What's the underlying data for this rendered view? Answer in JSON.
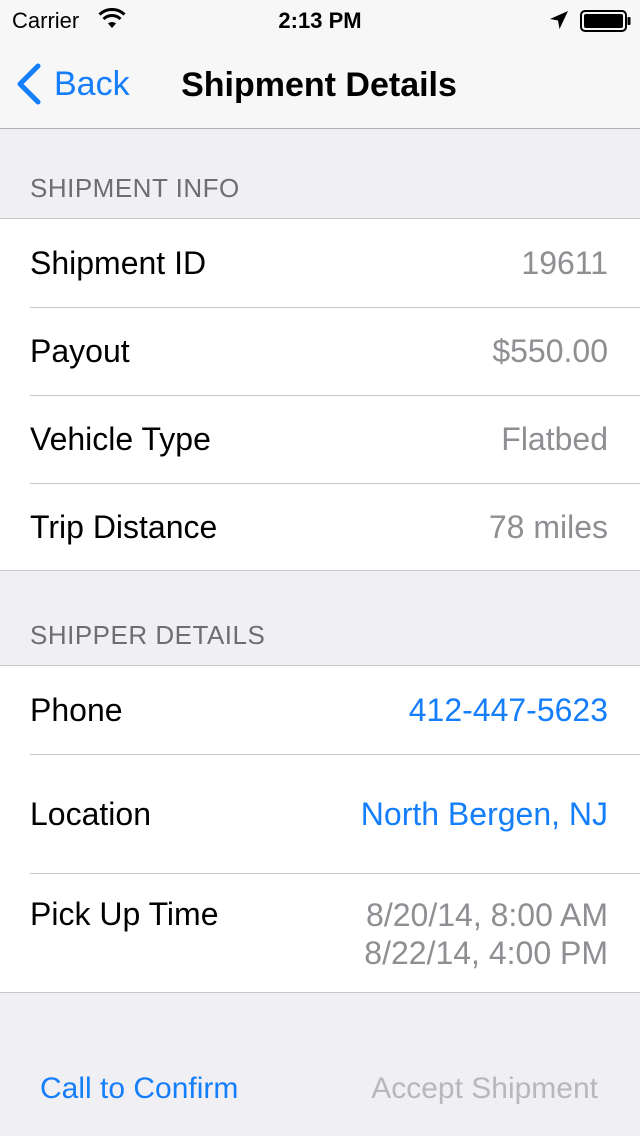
{
  "status_bar": {
    "carrier": "Carrier",
    "time": "2:13 PM",
    "icons": [
      "wifi-icon",
      "location-arrow-icon",
      "battery-icon"
    ]
  },
  "nav": {
    "back_label": "Back",
    "title": "Shipment Details",
    "accent_color": "#147efb"
  },
  "shipment_info": {
    "header": "SHIPMENT INFO",
    "rows": [
      {
        "label": "Shipment ID",
        "value": "19611"
      },
      {
        "label": "Payout",
        "value": "$550.00"
      },
      {
        "label": "Vehicle Type",
        "value": "Flatbed"
      },
      {
        "label": "Trip Distance",
        "value": "78 miles"
      }
    ]
  },
  "shipper_details": {
    "header": "SHIPPER DETAILS",
    "phone": {
      "label": "Phone",
      "value": "412-447-5623"
    },
    "location": {
      "label": "Location",
      "value": "North Bergen, NJ"
    },
    "pickup": {
      "label": "Pick Up Time",
      "start": "8/20/14, 8:00 AM",
      "end": "8/22/14, 4:00 PM"
    }
  },
  "toolbar": {
    "call_label": "Call to Confirm",
    "accept_label": "Accept Shipment"
  }
}
